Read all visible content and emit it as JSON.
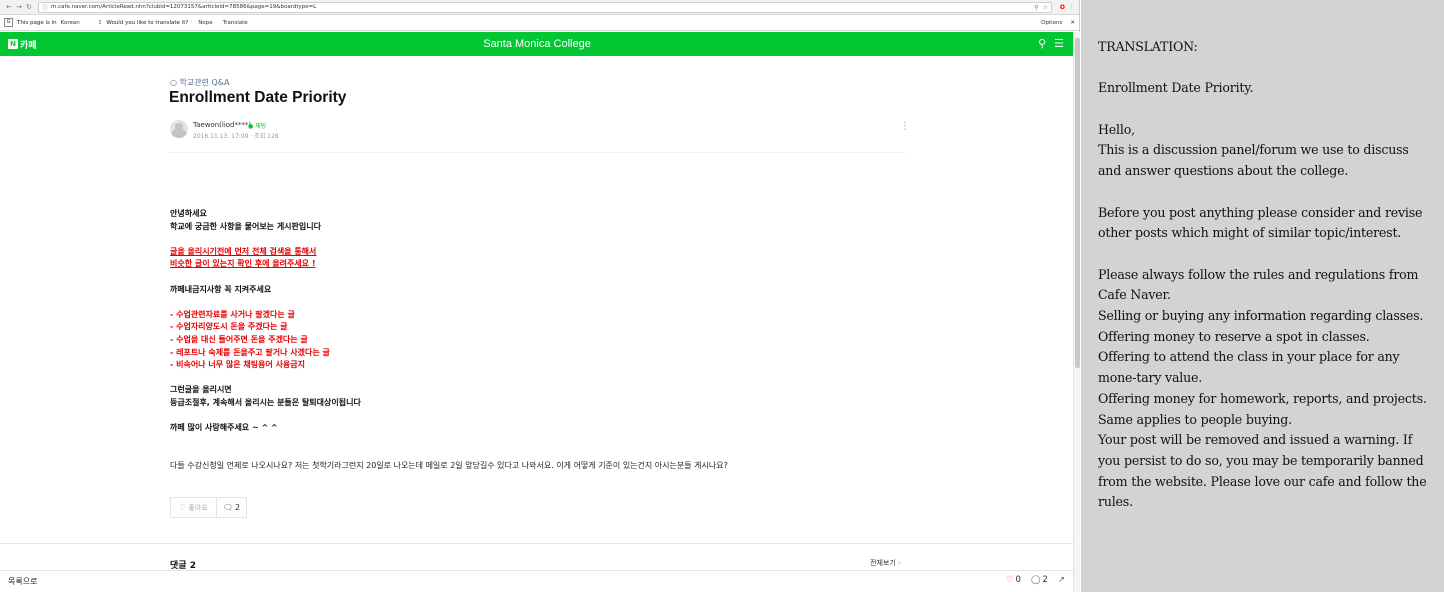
{
  "browser": {
    "url": "m.cafe.naver.com/ArticleRead.nhn?clubid=12073157&articleid=78586&page=19&boardtype=L",
    "translate_bar": {
      "page_in": "This page is in",
      "source_lang": "Korean",
      "prompt": "Would you like to translate it?",
      "nope": "Nope",
      "translate": "Translate",
      "options": "Options"
    }
  },
  "cafe": {
    "logo_label": "카페",
    "title": "Santa Monica College"
  },
  "post": {
    "board": "학교관련 Q&A",
    "title": "Enrollment Date Priority",
    "author": "Taewon(liod****)",
    "author_badge": "채팅",
    "date": "2016.11.13. 17:09",
    "views": "조회 128",
    "lines": [
      {
        "text": "안녕하세요",
        "style": "b"
      },
      {
        "text": "학교에 궁금한 사항을 물어보는 게시판입니다",
        "style": "b"
      },
      {
        "text": "",
        "style": "gap"
      },
      {
        "text": "글을 올리시기전에 먼저 전체 검색을 통해서",
        "style": "ru"
      },
      {
        "text": "비슷한 글이 있는지 확인 후에 올려주세요 !",
        "style": "ru"
      },
      {
        "text": "",
        "style": "gap"
      },
      {
        "text": "까페내금지사항 꼭 지켜주세요",
        "style": "b"
      },
      {
        "text": "",
        "style": "gap"
      },
      {
        "text": "- 수업관련자료를 사거나 팔겠다는 글",
        "style": "r"
      },
      {
        "text": "- 수업자리양도시 돈을 주겠다는 글",
        "style": "r"
      },
      {
        "text": "- 수업을 대신 들어주면 돈을 주겠다는 글",
        "style": "r"
      },
      {
        "text": "- 레포트나 숙제를 돈을주고 팔거나 사겠다는 글",
        "style": "r"
      },
      {
        "text": "- 비속어나 너무 많은 채팅용어 사용금지",
        "style": "r"
      },
      {
        "text": "",
        "style": "gap"
      },
      {
        "text": "그런글을 올리시면",
        "style": "b"
      },
      {
        "text": "등급조절후, 계속해서 올리시는 분들은 탈퇴대상이됩니다",
        "style": "b"
      },
      {
        "text": "",
        "style": "gap"
      },
      {
        "text": "까페 많이 사랑해주세요 ~ ^ ^",
        "style": "b"
      }
    ],
    "question": "다들 수강신청일 언제로 나오시나요? 저는 첫학기라그런지 20일로 나오는데 메일로 2일 앞당길수 있다고 나와서요. 이게 어떻게 기준이 있는건지 아시는분들 게시나요?",
    "like_label": "좋아요",
    "comment_count": "2"
  },
  "comments": {
    "heading": "댓글 2",
    "view_all": "전체보기"
  },
  "bottom_bar": {
    "to_list": "목록으로",
    "likes": "0",
    "comments": "2"
  },
  "translation": {
    "lines": [
      "TRANSLATION:",
      "",
      "Enrollment Date Priority.",
      "",
      "Hello,",
      "This is a discussion panel/forum we use to discuss and answer questions about the college.",
      "",
      "Before you post anything please consider and revise other posts which might of similar topic/interest.",
      "",
      "Please always follow the rules and regulations from Cafe Naver.",
      "Selling or buying any information regarding classes.",
      "Offering money to reserve a spot in classes.",
      "Offering to attend the class in your place for any mone-tary value.",
      "Offering money for homework, reports, and projects.",
      "Same applies to people buying.",
      "Your post will be removed and issued a warning. If you persist to do so, you may be temporarily banned from the website. Please love our cafe and follow the rules."
    ]
  }
}
